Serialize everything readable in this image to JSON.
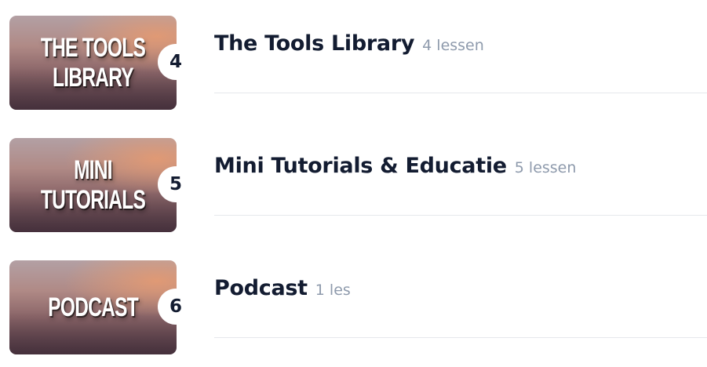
{
  "courses": [
    {
      "thumbnail_text": "THE TOOLS\nLIBRARY",
      "number": "4",
      "title": "The Tools Library",
      "lessons": "4 lessen"
    },
    {
      "thumbnail_text": "MINI TUTORIALS",
      "number": "5",
      "title": "Mini Tutorials & Educatie",
      "lessons": "5 lessen"
    },
    {
      "thumbnail_text": "PODCAST",
      "number": "6",
      "title": "Podcast",
      "lessons": "1 les"
    }
  ],
  "colors": {
    "title": "#131c31",
    "lesson_count": "#8e9aac",
    "divider": "#e6e8ec",
    "badge_bg": "#ffffff"
  }
}
